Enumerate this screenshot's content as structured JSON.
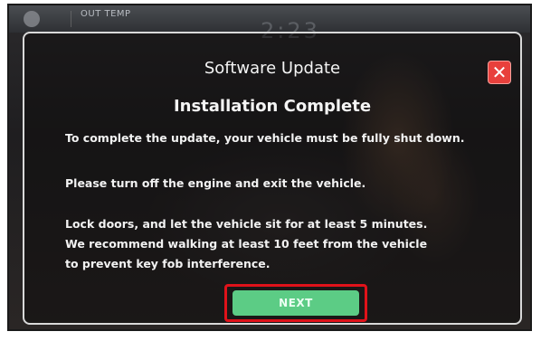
{
  "statusbar": {
    "out_temp_label": "OUT TEMP",
    "clock": "2:23"
  },
  "dialog": {
    "title": "Software Update",
    "subtitle": "Installation Complete",
    "close_glyph": "✕",
    "lines": [
      "To complete the update, your vehicle must be fully shut down.",
      "Please turn off the engine and exit the vehicle.",
      "Lock doors, and let the vehicle sit for at least 5 minutes.",
      "We recommend walking at least 10 feet from the vehicle",
      "to prevent key fob interference."
    ],
    "next_label": "NEXT"
  },
  "colors": {
    "close_button": "#e8403c",
    "next_button": "#5ccc85",
    "highlight": "#e0121a"
  },
  "icons": {
    "settings": "gear-icon",
    "close": "close-icon"
  }
}
